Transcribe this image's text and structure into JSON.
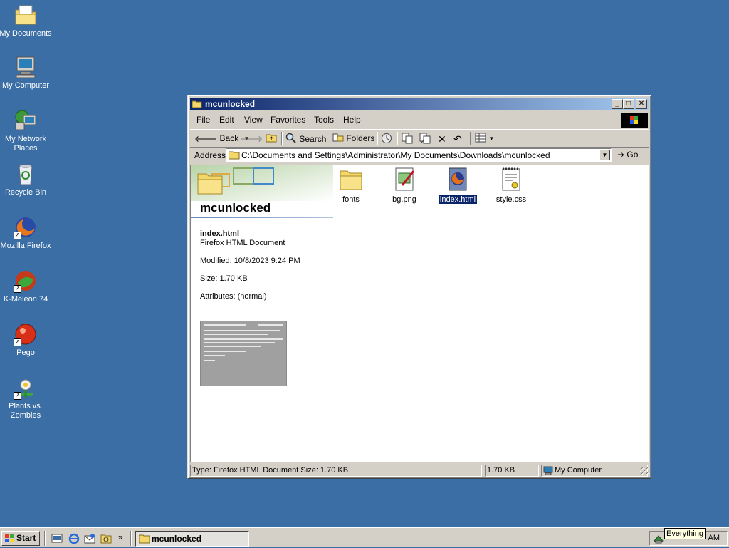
{
  "desktop": {
    "icons": [
      {
        "label": "My Documents"
      },
      {
        "label": "My Computer"
      },
      {
        "label": "My Network Places"
      },
      {
        "label": "Recycle Bin"
      },
      {
        "label": "Mozilla Firefox"
      },
      {
        "label": "K-Meleon 74"
      },
      {
        "label": "Pego"
      },
      {
        "label": "Plants vs. Zombies"
      }
    ]
  },
  "window": {
    "title": "mcunlocked",
    "menu": [
      "File",
      "Edit",
      "View",
      "Favorites",
      "Tools",
      "Help"
    ],
    "toolbar": {
      "back": "Back",
      "search": "Search",
      "folders": "Folders"
    },
    "address": {
      "label": "Address",
      "value": "C:\\Documents and Settings\\Administrator\\My Documents\\Downloads\\mcunlocked",
      "go": "Go"
    },
    "folder_name": "mcunlocked",
    "details": {
      "name": "index.html",
      "type": "Firefox HTML Document",
      "modified": "Modified: 10/8/2023 9:24 PM",
      "size": "Size: 1.70 KB",
      "attributes": "Attributes: (normal)"
    },
    "files": [
      {
        "name": "fonts",
        "icon": "folder-icon"
      },
      {
        "name": "bg.png",
        "icon": "image-file-icon"
      },
      {
        "name": "index.html",
        "icon": "firefox-html-icon",
        "selected": true
      },
      {
        "name": "style.css",
        "icon": "css-file-icon"
      }
    ],
    "status": {
      "type_text": "Type: Firefox HTML Document Size: 1.70 KB",
      "size": "1.70 KB",
      "zone": "My Computer"
    }
  },
  "taskbar": {
    "start": "Start",
    "task": "mcunlocked",
    "tooltip": "Everything"
  },
  "colors": {
    "desktop": "#3a6ea5",
    "title_active": "#0a246a",
    "selection": "#0a246a"
  }
}
